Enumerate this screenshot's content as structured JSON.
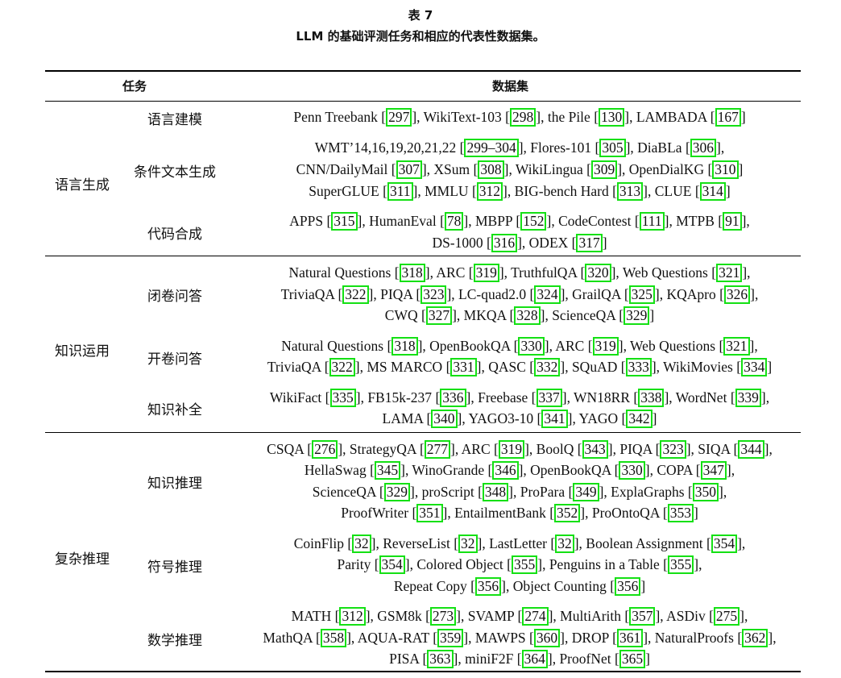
{
  "caption": {
    "label": "表 7",
    "title": "LLM 的基础评测任务和相应的代表性数据集。"
  },
  "header": {
    "task": "任务",
    "dataset": "数据集"
  },
  "categories": [
    "语言生成",
    "知识运用",
    "复杂推理"
  ],
  "tasks": [
    "语言建模",
    "条件文本生成",
    "代码合成",
    "闭卷问答",
    "开卷问答",
    "知识补全",
    "知识推理",
    "符号推理",
    "数学推理"
  ],
  "rows": [
    [
      [
        "Penn Treebank ",
        "297"
      ],
      [
        ", WikiText-103 ",
        "298"
      ],
      [
        ", the Pile ",
        "130"
      ],
      [
        ", LAMBADA ",
        "167"
      ]
    ],
    [
      [
        "WMT’14,16,19,20,21,22 ",
        "299–304"
      ],
      [
        ", Flores-101 ",
        "305"
      ],
      [
        ", DiaBLa ",
        "306"
      ],
      [
        ",",
        ""
      ]
    ],
    [
      [
        "CNN/DailyMail ",
        "307"
      ],
      [
        ", XSum ",
        "308"
      ],
      [
        ", WikiLingua ",
        "309"
      ],
      [
        ", OpenDialKG ",
        "310"
      ]
    ],
    [
      [
        "SuperGLUE ",
        "311"
      ],
      [
        ", MMLU ",
        "312"
      ],
      [
        ", BIG-bench Hard ",
        "313"
      ],
      [
        ", CLUE ",
        "314"
      ]
    ],
    [
      [
        "APPS ",
        "315"
      ],
      [
        ", HumanEval ",
        "78"
      ],
      [
        ", MBPP ",
        "152"
      ],
      [
        ", CodeContest ",
        "111"
      ],
      [
        ", MTPB ",
        "91"
      ],
      [
        ",",
        ""
      ]
    ],
    [
      [
        "DS-1000 ",
        "316"
      ],
      [
        ", ODEX ",
        "317"
      ]
    ],
    [
      [
        "Natural Questions ",
        "318"
      ],
      [
        ", ARC ",
        "319"
      ],
      [
        ", TruthfulQA ",
        "320"
      ],
      [
        ", Web Questions ",
        "321"
      ],
      [
        ",",
        ""
      ]
    ],
    [
      [
        "TriviaQA ",
        "322"
      ],
      [
        ", PIQA ",
        "323"
      ],
      [
        ", LC-quad2.0 ",
        "324"
      ],
      [
        ", GrailQA ",
        "325"
      ],
      [
        ", KQApro ",
        "326"
      ],
      [
        ",",
        ""
      ]
    ],
    [
      [
        "CWQ ",
        "327"
      ],
      [
        ", MKQA ",
        "328"
      ],
      [
        ", ScienceQA ",
        "329"
      ]
    ],
    [
      [
        "Natural Questions ",
        "318"
      ],
      [
        ", OpenBookQA ",
        "330"
      ],
      [
        ", ARC ",
        "319"
      ],
      [
        ", Web Questions ",
        "321"
      ],
      [
        ",",
        ""
      ]
    ],
    [
      [
        "TriviaQA ",
        "322"
      ],
      [
        ", MS MARCO ",
        "331"
      ],
      [
        ", QASC ",
        "332"
      ],
      [
        ", SQuAD ",
        "333"
      ],
      [
        ", WikiMovies ",
        "334"
      ]
    ],
    [
      [
        "WikiFact ",
        "335"
      ],
      [
        ", FB15k-237 ",
        "336"
      ],
      [
        ", Freebase ",
        "337"
      ],
      [
        ", WN18RR ",
        "338"
      ],
      [
        ", WordNet ",
        "339"
      ],
      [
        ",",
        ""
      ]
    ],
    [
      [
        "LAMA ",
        "340"
      ],
      [
        ", YAGO3-10 ",
        "341"
      ],
      [
        ", YAGO ",
        "342"
      ]
    ],
    [
      [
        "CSQA ",
        "276"
      ],
      [
        ", StrategyQA ",
        "277"
      ],
      [
        ", ARC ",
        "319"
      ],
      [
        ", BoolQ ",
        "343"
      ],
      [
        ", PIQA ",
        "323"
      ],
      [
        ", SIQA ",
        "344"
      ],
      [
        ",",
        ""
      ]
    ],
    [
      [
        "HellaSwag ",
        "345"
      ],
      [
        ", WinoGrande ",
        "346"
      ],
      [
        ", OpenBookQA ",
        "330"
      ],
      [
        ", COPA ",
        "347"
      ],
      [
        ",",
        ""
      ]
    ],
    [
      [
        "ScienceQA ",
        "329"
      ],
      [
        ", proScript ",
        "348"
      ],
      [
        ", ProPara ",
        "349"
      ],
      [
        ", ExplaGraphs ",
        "350"
      ],
      [
        ",",
        ""
      ]
    ],
    [
      [
        "ProofWriter ",
        "351"
      ],
      [
        ", EntailmentBank ",
        "352"
      ],
      [
        ", ProOntoQA ",
        "353"
      ]
    ],
    [
      [
        "CoinFlip ",
        "32"
      ],
      [
        ", ReverseList ",
        "32"
      ],
      [
        ", LastLetter ",
        "32"
      ],
      [
        ", Boolean Assignment ",
        "354"
      ],
      [
        ",",
        ""
      ]
    ],
    [
      [
        "Parity ",
        "354"
      ],
      [
        ", Colored Object ",
        "355"
      ],
      [
        ", Penguins in a Table ",
        "355"
      ],
      [
        ",",
        ""
      ]
    ],
    [
      [
        "Repeat Copy ",
        "356"
      ],
      [
        ", Object Counting ",
        "356"
      ]
    ],
    [
      [
        "MATH ",
        "312"
      ],
      [
        ", GSM8k ",
        "273"
      ],
      [
        ", SVAMP ",
        "274"
      ],
      [
        ", MultiArith ",
        "357"
      ],
      [
        ", ASDiv ",
        "275"
      ],
      [
        ",",
        ""
      ]
    ],
    [
      [
        "MathQA ",
        "358"
      ],
      [
        ", AQUA-RAT ",
        "359"
      ],
      [
        ", MAWPS ",
        "360"
      ],
      [
        ", DROP ",
        "361"
      ],
      [
        ", NaturalProofs ",
        "362"
      ],
      [
        ",",
        ""
      ]
    ],
    [
      [
        "PISA ",
        "363"
      ],
      [
        ", miniF2F ",
        "364"
      ],
      [
        ", ProofNet ",
        "365"
      ]
    ]
  ],
  "colors": {
    "ref_box": "#14e014",
    "rule": "#000000"
  }
}
